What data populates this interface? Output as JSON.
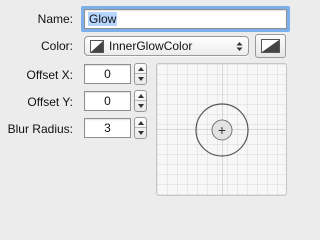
{
  "name_row": {
    "label": "Name:",
    "value": "Glow"
  },
  "color_row": {
    "label": "Color:",
    "selected": "InnerGlowColor"
  },
  "offset_x": {
    "label": "Offset X:",
    "value": "0"
  },
  "offset_y": {
    "label": "Offset Y:",
    "value": "0"
  },
  "blur_radius": {
    "label": "Blur Radius:",
    "value": "3"
  },
  "offset_pad": {
    "crosshair_glyph": "+"
  },
  "colors": {
    "background": "#ececec",
    "focus_ring": "#7cb0ea",
    "selection": "#b5d5ff"
  }
}
